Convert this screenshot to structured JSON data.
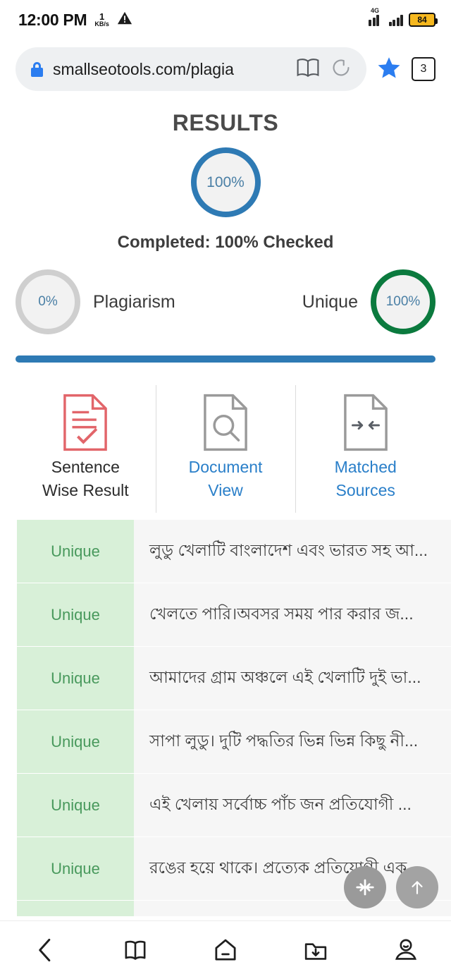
{
  "status_bar": {
    "time": "12:00 PM",
    "network_speed_value": "1",
    "network_speed_unit": "KB/s",
    "warning_icon": "warning-triangle-icon",
    "signal_4g_label": "4G",
    "battery_level": "84",
    "battery_color": "#f6b81f"
  },
  "browser": {
    "url": "smallseotools.com/plagia",
    "lock_icon": "lock-icon",
    "lock_color": "#2b7df0",
    "bookmark_icon": "book-icon",
    "reload_icon": "reload-icon",
    "star_icon": "star-icon",
    "star_color": "#2b7df0",
    "tab_count": "3"
  },
  "results": {
    "title": "RESULTS",
    "main_circle_value": "100%",
    "main_circle_color": "#2e7ab4",
    "completed_text": "Completed: 100% Checked",
    "progress_color": "#2e7ab4",
    "stats": [
      {
        "value": "0%",
        "label": "Plagiarism",
        "ring_color": "#cfcfcf",
        "position": "left"
      },
      {
        "value": "100%",
        "label": "Unique",
        "ring_color": "#0b7a3e",
        "position": "right"
      }
    ]
  },
  "tabs": [
    {
      "label_line1": "Sentence",
      "label_line2": "Wise Result",
      "icon": "document-check-icon",
      "icon_color": "#e2656a",
      "active": true
    },
    {
      "label_line1": "Document",
      "label_line2": "View",
      "icon": "document-search-icon",
      "icon_color": "#9a9a9a",
      "active": false
    },
    {
      "label_line1": "Matched",
      "label_line2": "Sources",
      "icon": "document-arrows-icon",
      "icon_color": "#9a9a9a",
      "active": false
    }
  ],
  "sentence_rows": [
    {
      "status": "Unique",
      "text": "লুডু খেলাটি বাংলাদেশ এবং ভারত সহ আ..."
    },
    {
      "status": "Unique",
      "text": "খেলতে পারি।অবসর সময় পার করার জ..."
    },
    {
      "status": "Unique",
      "text": "আমাদের গ্রাম অঞ্চলে এই খেলাটি দুই ভা..."
    },
    {
      "status": "Unique",
      "text": "সাপা লুডু। দুটি পদ্ধতির ভিন্ন ভিন্ন কিছু নী..."
    },
    {
      "status": "Unique",
      "text": "এই খেলায় সর্বোচ্চ পাঁচ জন প্রতিযোগী ..."
    },
    {
      "status": "Unique",
      "text": "রঙের হয়ে থাকে। প্রত্যেক প্রতিযোগী এক..."
    }
  ],
  "floating_buttons": [
    {
      "icon": "collapse-horizontal-icon"
    },
    {
      "icon": "scroll-up-arrow-icon"
    }
  ],
  "bottom_nav": [
    {
      "icon": "back-chevron-icon"
    },
    {
      "icon": "bookmarks-book-icon"
    },
    {
      "icon": "home-icon"
    },
    {
      "icon": "downloads-folder-icon"
    },
    {
      "icon": "profile-person-icon"
    }
  ]
}
